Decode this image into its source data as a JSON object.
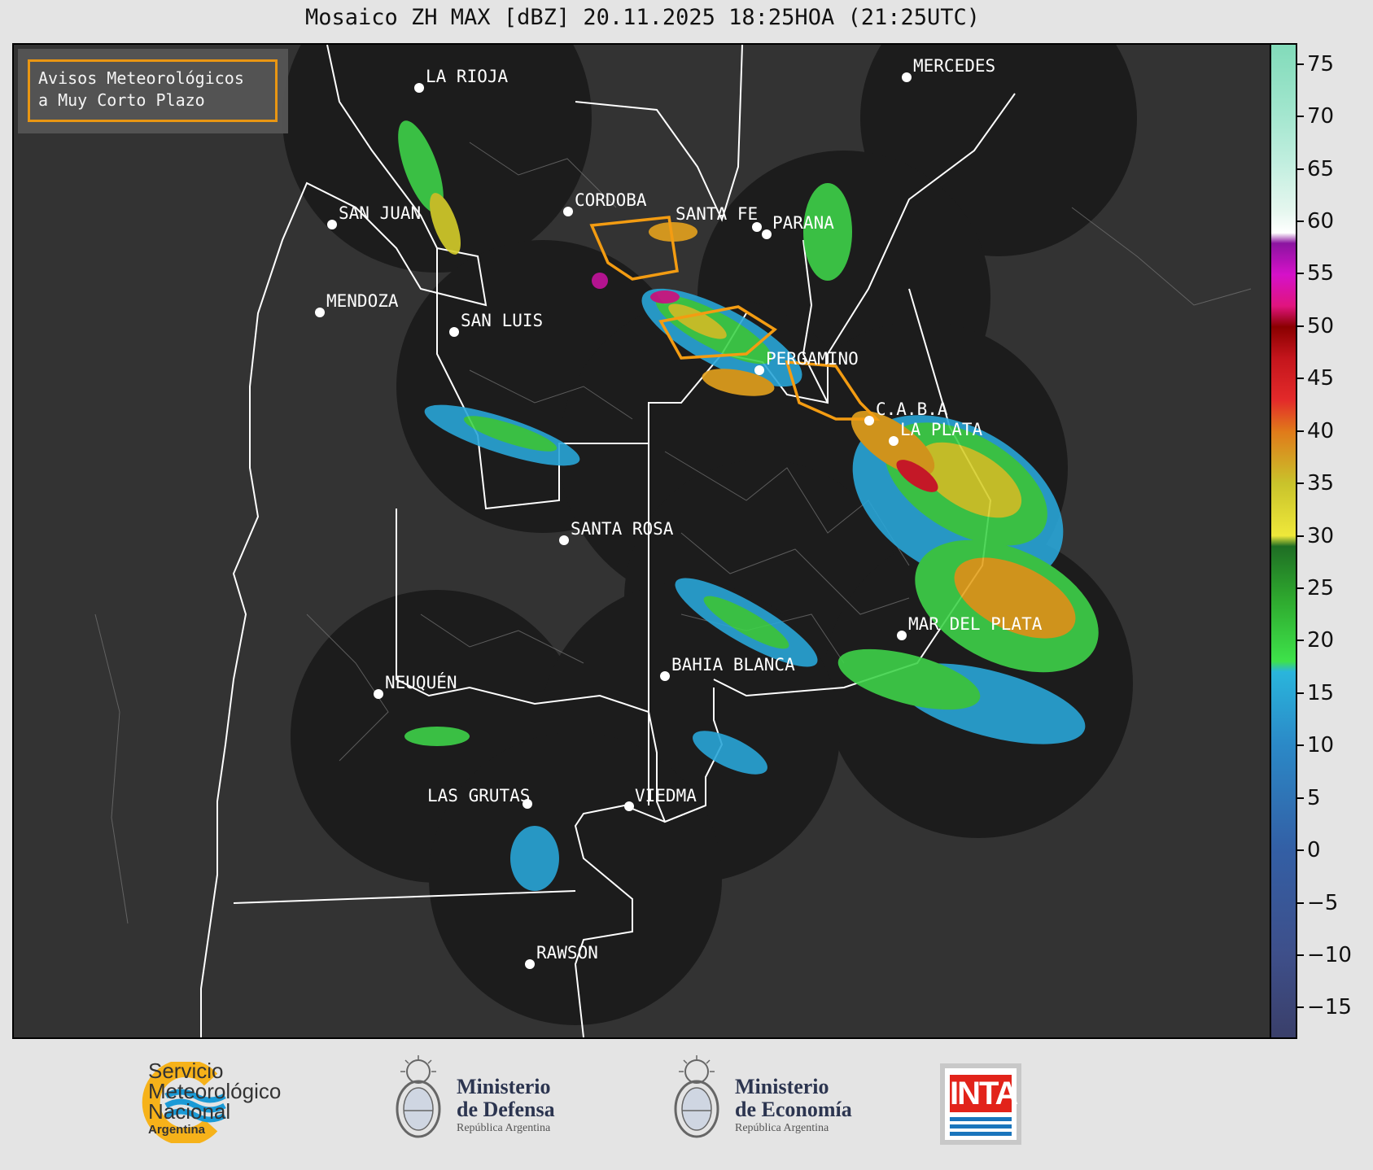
{
  "title": "Mosaico ZH MAX [dBZ] 20.11.2025 18:25HOA (21:25UTC)",
  "legend": {
    "line1": "Avisos Meteorológicos",
    "line2": "a Muy Corto Plazo",
    "color": "#f39c12"
  },
  "colorbar": {
    "unit": "dBZ",
    "ticks": [
      "75",
      "70",
      "65",
      "60",
      "55",
      "50",
      "45",
      "40",
      "35",
      "30",
      "25",
      "20",
      "15",
      "10",
      "5",
      "0",
      "−5",
      "−10",
      "−15"
    ],
    "range": [
      -18,
      77
    ]
  },
  "cities": [
    {
      "name": "LA RIOJA"
    },
    {
      "name": "MERCEDES"
    },
    {
      "name": "SAN JUAN"
    },
    {
      "name": "CORDOBA"
    },
    {
      "name": "SANTA FE"
    },
    {
      "name": "PARANA"
    },
    {
      "name": "MENDOZA"
    },
    {
      "name": "SAN LUIS"
    },
    {
      "name": "PERGAMINO"
    },
    {
      "name": "C.A.B.A"
    },
    {
      "name": "LA PLATA"
    },
    {
      "name": "SANTA ROSA"
    },
    {
      "name": "MAR DEL PLATA"
    },
    {
      "name": "BAHIA BLANCA"
    },
    {
      "name": "NEUQUÉN"
    },
    {
      "name": "LAS GRUTAS"
    },
    {
      "name": "VIEDMA"
    },
    {
      "name": "RAWSON"
    }
  ],
  "footer": {
    "smn": {
      "line1": "Servicio",
      "line2": "Meteorológico",
      "line3": "Nacional",
      "line4": "Argentina"
    },
    "defensa": {
      "line1": "Ministerio",
      "line2": "de Defensa",
      "line3": "República Argentina"
    },
    "economia": {
      "line1": "Ministerio",
      "line2": "de Economía",
      "line3": "República Argentina"
    },
    "inta": "INTA"
  }
}
